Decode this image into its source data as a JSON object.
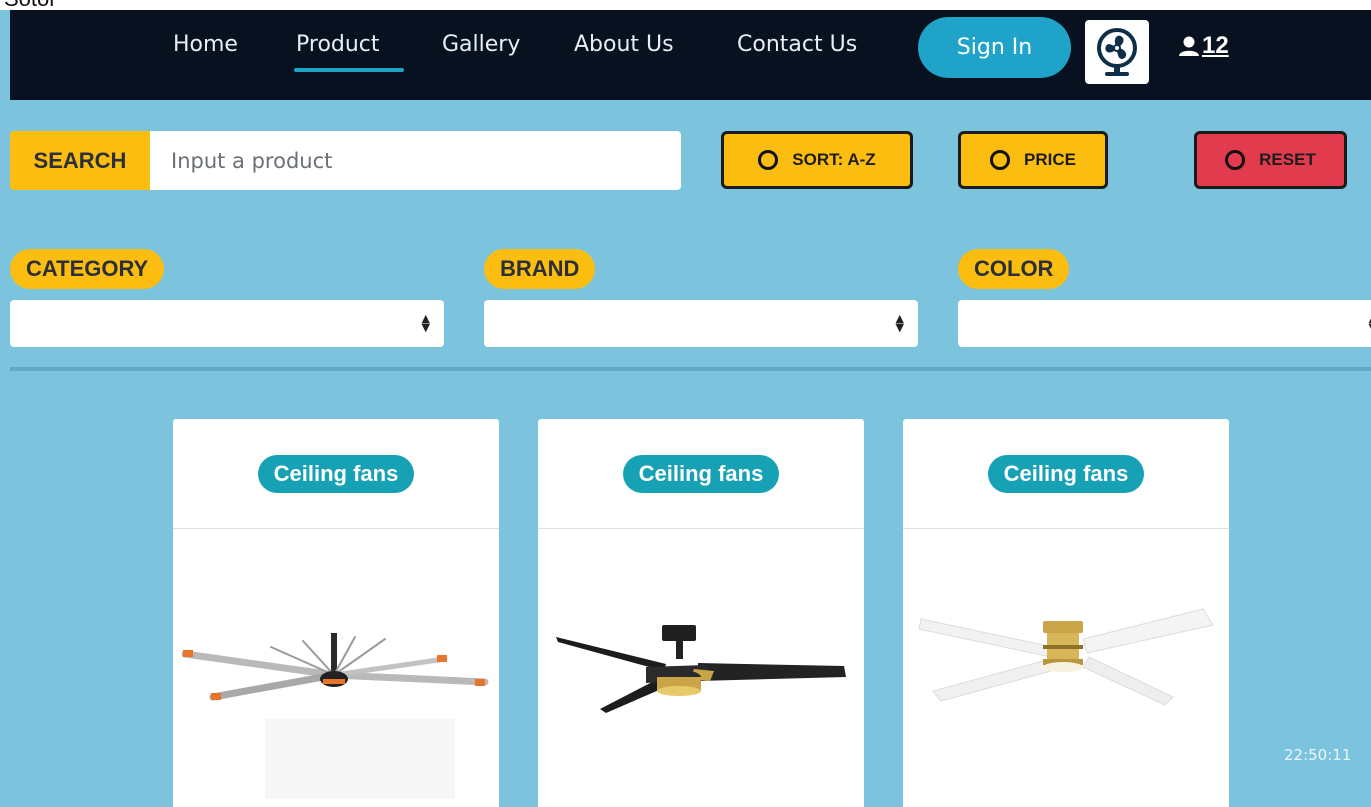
{
  "top_strip_text": "Sotor",
  "nav": {
    "links": [
      "Home",
      "Product",
      "Gallery",
      "About Us",
      "Contact Us"
    ],
    "signin_label": "Sign In",
    "user_count": "12"
  },
  "search": {
    "label": "SEARCH",
    "placeholder": "Input a product",
    "value": ""
  },
  "buttons": {
    "sort": "SORT: A-Z",
    "price": "PRICE",
    "reset": "RESET"
  },
  "filters": {
    "category": {
      "label": "CATEGORY",
      "selected": ""
    },
    "brand": {
      "label": "BRAND",
      "selected": ""
    },
    "color": {
      "label": "COLOR",
      "selected": ""
    }
  },
  "products": [
    {
      "category": "Ceiling fans",
      "image": "ceiling-fan-industrial-silver"
    },
    {
      "category": "Ceiling fans",
      "image": "ceiling-fan-black-gold-3-blade"
    },
    {
      "category": "Ceiling fans",
      "image": "ceiling-fan-white-brass-4-blade"
    }
  ],
  "clock": "22:50:11",
  "colors": {
    "navbar": "#08111f",
    "page_bg": "#7cc3dd",
    "accent_yellow": "#fbbd10",
    "reset_red": "#e23b4e",
    "signin_blue": "#1fa3c9",
    "badge_teal": "#17a1b4"
  }
}
